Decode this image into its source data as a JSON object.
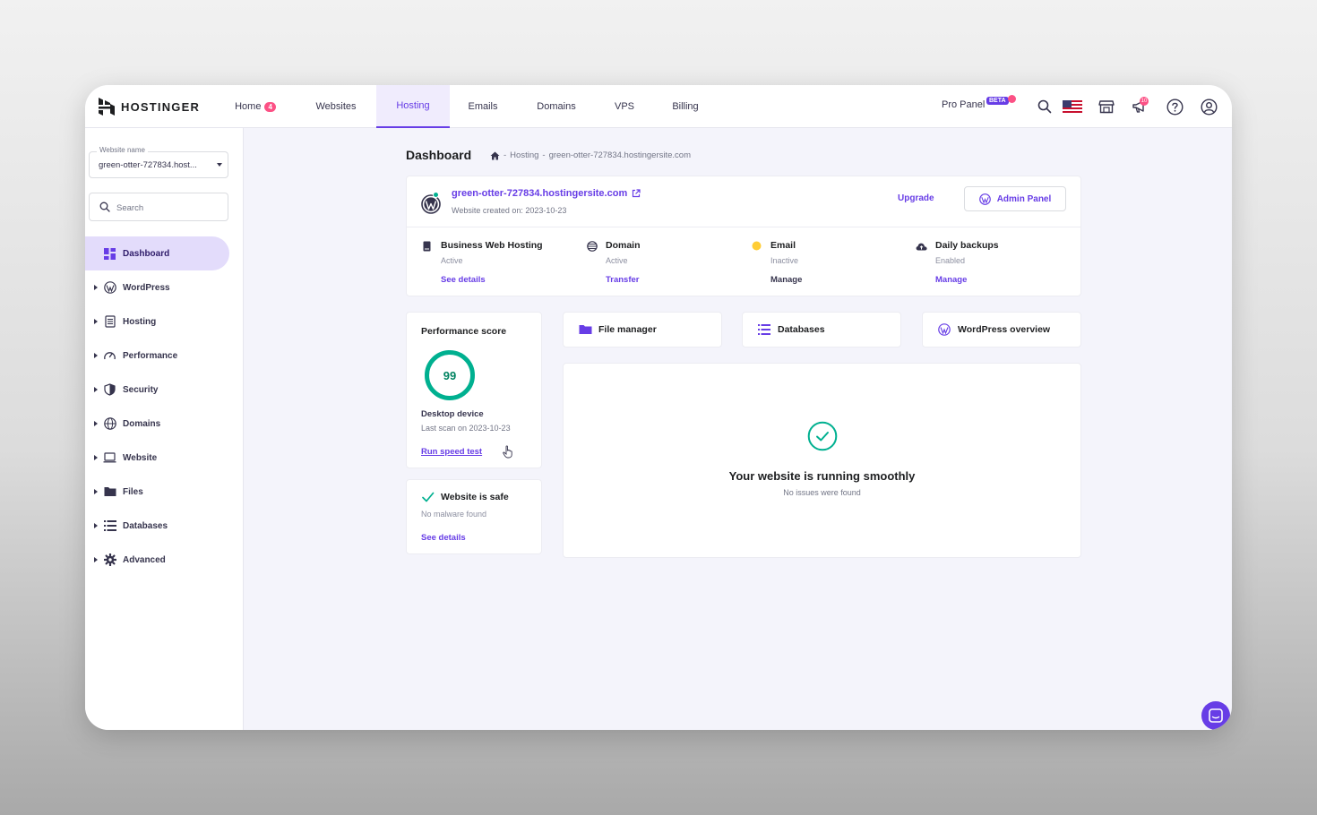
{
  "brand": {
    "name": "HOSTINGER"
  },
  "nav": {
    "items": [
      {
        "label": "Home",
        "badge": "4"
      },
      {
        "label": "Websites"
      },
      {
        "label": "Hosting"
      },
      {
        "label": "Emails"
      },
      {
        "label": "Domains"
      },
      {
        "label": "VPS"
      },
      {
        "label": "Billing"
      }
    ],
    "active": "Hosting",
    "pro_panel": "Pro Panel",
    "pro_badge": "BETA",
    "notifications_count": "10"
  },
  "sidebar": {
    "website_label": "Website name",
    "website_value": "green-otter-727834.host...",
    "search_placeholder": "Search",
    "items": [
      {
        "label": "Dashboard",
        "icon": "dashboard-icon",
        "active": true
      },
      {
        "label": "WordPress",
        "icon": "wordpress-icon"
      },
      {
        "label": "Hosting",
        "icon": "server-icon"
      },
      {
        "label": "Performance",
        "icon": "gauge-icon"
      },
      {
        "label": "Security",
        "icon": "shield-icon"
      },
      {
        "label": "Domains",
        "icon": "globe-icon"
      },
      {
        "label": "Website",
        "icon": "laptop-icon"
      },
      {
        "label": "Files",
        "icon": "folder-icon"
      },
      {
        "label": "Databases",
        "icon": "database-icon"
      },
      {
        "label": "Advanced",
        "icon": "gear-icon"
      }
    ]
  },
  "page": {
    "title": "Dashboard",
    "breadcrumb": [
      "Hosting",
      "green-otter-727834.hostingersite.com"
    ]
  },
  "site": {
    "url": "green-otter-727834.hostingersite.com",
    "created": "Website created on: 2023-10-23",
    "upgrade_label": "Upgrade",
    "admin_label": "Admin Panel"
  },
  "services": [
    {
      "name": "Business Web Hosting",
      "status": "Active",
      "link": "See details"
    },
    {
      "name": "Domain",
      "status": "Active",
      "link": "Transfer"
    },
    {
      "name": "Email",
      "status": "Inactive",
      "link": "Manage"
    },
    {
      "name": "Daily backups",
      "status": "Enabled",
      "link": "Manage"
    }
  ],
  "performance": {
    "title": "Performance score",
    "score": "99",
    "score_fraction": 0.99,
    "device": "Desktop device",
    "last_scan": "Last scan on 2023-10-23",
    "link": "Run speed test"
  },
  "safety": {
    "title": "Website is safe",
    "subtitle": "No malware found",
    "link": "See details"
  },
  "tiles": [
    {
      "label": "File manager",
      "icon": "folder-icon"
    },
    {
      "label": "Databases",
      "icon": "database-icon"
    },
    {
      "label": "WordPress overview",
      "icon": "wordpress-icon"
    }
  ],
  "status": {
    "title": "Your website is running smoothly",
    "subtitle": "No issues were found"
  },
  "colors": {
    "accent": "#673de6",
    "success": "#00b090",
    "warning": "#ffcd35",
    "danger": "#fc5185"
  }
}
